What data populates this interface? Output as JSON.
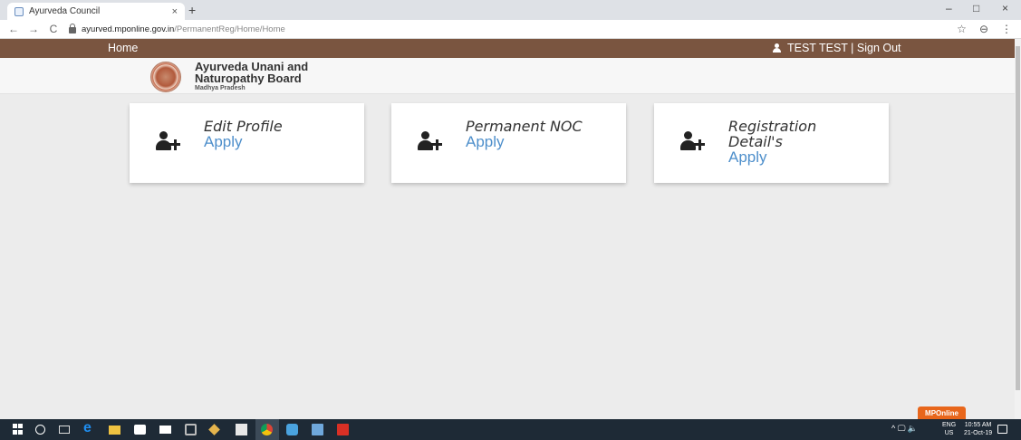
{
  "browser": {
    "tab_title": "Ayurveda Council",
    "tab_close": "×",
    "new_tab": "+",
    "url_host": "ayurved.mponline.gov.in",
    "url_path": "/PermanentReg/Home/Home",
    "back": "←",
    "forward": "→",
    "reload": "C",
    "star": "☆",
    "profile": "⊖",
    "menu": "⋮",
    "minimize": "–",
    "maximize": "□",
    "close": "×"
  },
  "nav": {
    "home_label": "Home",
    "user_label": "TEST TEST | Sign Out"
  },
  "brand": {
    "line1": "Ayurveda Unani and",
    "line2": "Naturopathy Board",
    "line3": "Madhya Pradesh"
  },
  "cards": [
    {
      "title": "Edit Profile",
      "action": "Apply",
      "icon": "add-user-icon"
    },
    {
      "title": "Permanent NOC",
      "action": "Apply",
      "icon": "add-user-icon"
    },
    {
      "title_line1": "Registration",
      "title_line2": "Detail's",
      "action": "Apply",
      "icon": "add-user-icon"
    }
  ],
  "badge": {
    "label": "MPOnline",
    "color": "#e8661b"
  },
  "taskbar": {
    "tray_symbols": "^ 🖵 🔈",
    "lang_line1": "ENG",
    "lang_line2": "US",
    "time": "10:55 AM",
    "date": "21-Oct-19"
  },
  "colors": {
    "nav_bg": "#7a5540",
    "apply_link": "#4e8fcb",
    "page_bg": "#ececec"
  }
}
